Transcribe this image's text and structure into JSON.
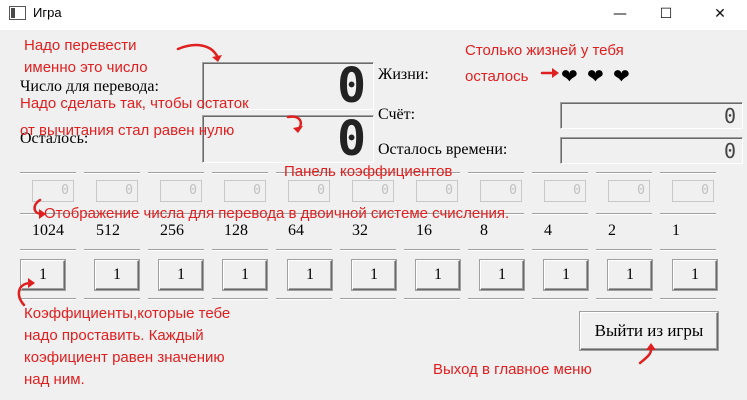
{
  "window": {
    "title": "Игра",
    "minimize_glyph": "—",
    "maximize_glyph": "☐",
    "close_glyph": "✕"
  },
  "labels": {
    "number_to_convert": "Число для перевода:",
    "remaining": "Осталось:",
    "lives": "Жизни:",
    "score": "Счёт:",
    "time_left": "Осталось времени:"
  },
  "displays": {
    "number_to_convert": "0",
    "remaining": "0",
    "score": "0",
    "time_left": "0"
  },
  "lives": [
    "❤",
    "❤",
    "❤"
  ],
  "bits": [
    "0",
    "0",
    "0",
    "0",
    "0",
    "0",
    "0",
    "0",
    "0",
    "0",
    "0"
  ],
  "powers": [
    "1024",
    "512",
    "256",
    "128",
    "64",
    "32",
    "16",
    "8",
    "4",
    "2",
    "1"
  ],
  "coefficients": [
    "1",
    "1",
    "1",
    "1",
    "1",
    "1",
    "1",
    "1",
    "1",
    "1",
    "1"
  ],
  "exit_button": "Выйти из игры",
  "annotations": {
    "convert_exactly": "Надо перевести\nименно это число",
    "make_zero": "Надо сделать так, чтобы остаток\nот вычитания стал равен нулю",
    "lives_left": "Столько жизней у тебя\nосталось",
    "coef_panel": "Панель коэффициентов",
    "binary_display": "Отображение числа для перевода в двоичной системе счисления.",
    "coef_hint": "Коэффициенты,которые тебе\nнадо проставить. Каждый\nкоэфициент равен значению\nнад ним.",
    "exit_menu": "Выход в главное меню"
  },
  "colors": {
    "annotation": "#e02020",
    "background": "#f0f0f0"
  }
}
